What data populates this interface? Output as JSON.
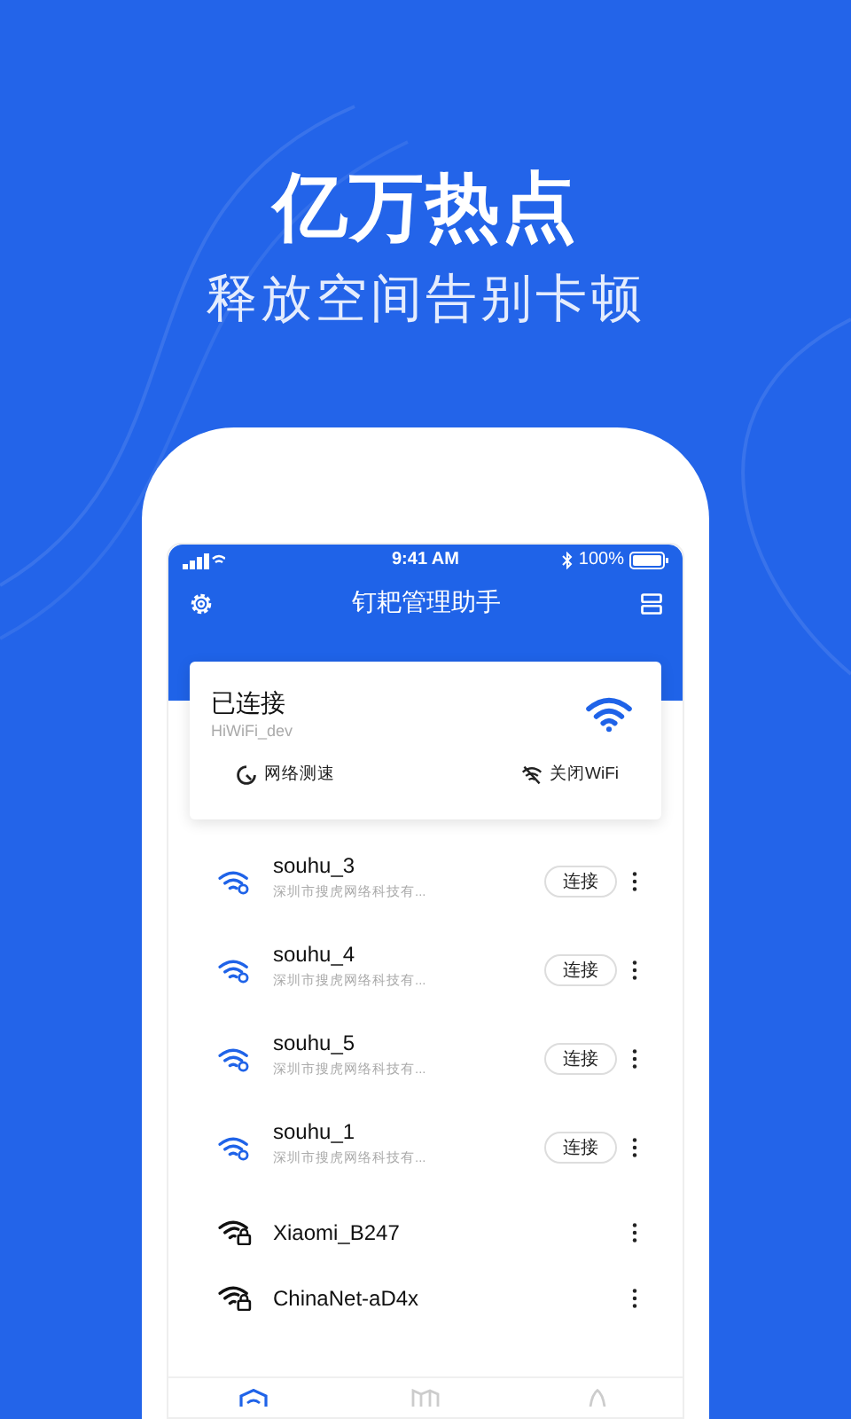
{
  "headline": "亿万热点",
  "tagline": "释放空间告别卡顿",
  "status_bar": {
    "time": "9:41 AM",
    "battery": "100%"
  },
  "app_bar": {
    "title": "钉耙管理助手"
  },
  "connected_card": {
    "status": "已连接",
    "network": "HiWiFi_dev",
    "actions": [
      {
        "kind": "speed",
        "label": "网络测速"
      },
      {
        "kind": "wifi-off",
        "label": "关闭WiFi"
      }
    ]
  },
  "networks": [
    {
      "kind": "shared",
      "name": "souhu_3",
      "provider": "深圳市搜虎网络科技有...",
      "button": "连接"
    },
    {
      "kind": "shared",
      "name": "souhu_4",
      "provider": "深圳市搜虎网络科技有...",
      "button": "连接"
    },
    {
      "kind": "shared",
      "name": "souhu_5",
      "provider": "深圳市搜虎网络科技有...",
      "button": "连接"
    },
    {
      "kind": "shared",
      "name": "souhu_1",
      "provider": "深圳市搜虎网络科技有...",
      "button": "连接"
    },
    {
      "kind": "locked",
      "name": "Xiaomi_B247"
    },
    {
      "kind": "locked",
      "name": "ChinaNet-aD4x"
    }
  ],
  "bottom_tabs": [
    {
      "kind": "wifi",
      "selected": true
    },
    {
      "kind": "map",
      "selected": false
    },
    {
      "kind": "rocket",
      "selected": false
    }
  ]
}
